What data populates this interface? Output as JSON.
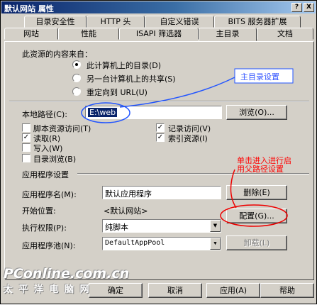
{
  "window": {
    "title": "默认网站 属性",
    "help_glyph": "?",
    "close_glyph": "X"
  },
  "tabs_row1": [
    "目录安全性",
    "HTTP 头",
    "自定义错误",
    "BITS 服务器扩展"
  ],
  "tabs_row2": [
    "网站",
    "性能",
    "ISAPI 筛选器",
    "主目录",
    "文档"
  ],
  "content_source": {
    "label": "此资源的内容来自：",
    "options": [
      "此计算机上的目录(D)",
      "另一台计算机上的共享(S)",
      "重定向到 URL(U)"
    ],
    "selected": 0
  },
  "local_path": {
    "label": "本地路径(C):",
    "value": "E:\\web",
    "browse_label": "浏览(O)..."
  },
  "checkboxes_left": [
    {
      "label": "脚本资源访问(T)",
      "checked": false
    },
    {
      "label": "读取(R)",
      "checked": true
    },
    {
      "label": "写入(W)",
      "checked": false
    },
    {
      "label": "目录浏览(B)",
      "checked": false
    }
  ],
  "checkboxes_right": [
    {
      "label": "记录访问(V)",
      "checked": true
    },
    {
      "label": "索引资源(I)",
      "checked": true
    }
  ],
  "app_settings": {
    "heading": "应用程序设置",
    "app_name_label": "应用程序名(M):",
    "app_name_value": "默认应用程序",
    "remove_label": "删除(E)",
    "start_label": "开始位置:",
    "start_value": "<默认网站>",
    "config_label": "配置(G)...",
    "exec_label": "执行权限(P):",
    "exec_value": "纯脚本",
    "pool_label": "应用程序池(N):",
    "pool_value": "DefaultAppPool",
    "unload_label": "卸载(L)"
  },
  "footer": {
    "ok": "确定",
    "cancel": "取消",
    "apply": "应用(A)",
    "help": "帮助"
  },
  "annotations": {
    "home_dir": "主目录设置",
    "config_line1": "单击进入进行启",
    "config_line2": "用父路径设置"
  },
  "watermark": {
    "line1": "PConline.com.cn",
    "line2": "太 平 洋 电 脑 网"
  },
  "colors": {
    "annot_red": "#ff0000",
    "annot_blue": "#3355ff",
    "face": "#d4d0c8"
  }
}
